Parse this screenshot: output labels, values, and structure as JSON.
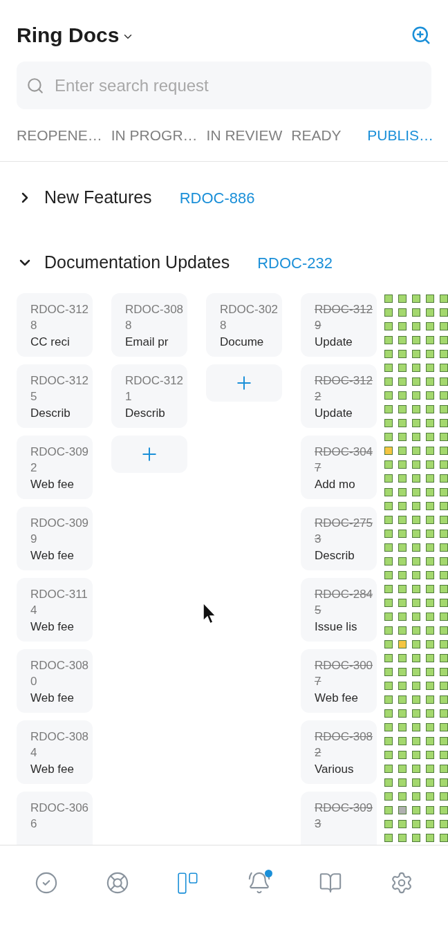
{
  "header": {
    "title": "Ring Docs"
  },
  "search": {
    "placeholder": "Enter search request"
  },
  "tabs": [
    {
      "label": "REOPENE…",
      "selected": false
    },
    {
      "label": "IN PROGR…",
      "selected": false
    },
    {
      "label": "IN REVIEW",
      "selected": false
    },
    {
      "label": "READY",
      "selected": false
    },
    {
      "label": "PUBLIS…",
      "selected": true
    }
  ],
  "groups": [
    {
      "name": "New Features",
      "issue": "RDOC-886",
      "expanded": false
    },
    {
      "name": "Documentation Updates",
      "issue": "RDOC-232",
      "expanded": true
    }
  ],
  "board": {
    "columns": [
      {
        "cards": [
          {
            "kind": "issue",
            "id": "RDOC-3128",
            "title": "CC reci",
            "resolved": false
          },
          {
            "kind": "issue",
            "id": "RDOC-3125",
            "title": "Describ",
            "resolved": false
          },
          {
            "kind": "issue",
            "id": "RDOC-3092",
            "title": "Web fee",
            "resolved": false
          },
          {
            "kind": "issue",
            "id": "RDOC-3099",
            "title": "Web fee",
            "resolved": false
          },
          {
            "kind": "issue",
            "id": "RDOC-3114",
            "title": "Web fee",
            "resolved": false
          },
          {
            "kind": "issue",
            "id": "RDOC-3080",
            "title": "Web fee",
            "resolved": false
          },
          {
            "kind": "issue",
            "id": "RDOC-3084",
            "title": "Web fee",
            "resolved": false
          },
          {
            "kind": "issue",
            "id": "RDOC-3066",
            "resolved": false
          }
        ]
      },
      {
        "cards": [
          {
            "kind": "issue",
            "id": "RDOC-3088",
            "title": "Email pr",
            "resolved": false
          },
          {
            "kind": "issue",
            "id": "RDOC-3121",
            "title": "Describ",
            "resolved": false
          },
          {
            "kind": "add"
          }
        ]
      },
      {
        "cards": [
          {
            "kind": "issue",
            "id": "RDOC-3028",
            "title": "Docume",
            "resolved": false
          },
          {
            "kind": "add"
          }
        ]
      },
      {
        "cards": [
          {
            "kind": "issue",
            "id": "RDOC-3129",
            "title": "Update",
            "resolved": true
          },
          {
            "kind": "issue",
            "id": "RDOC-3122",
            "title": "Update",
            "resolved": true
          },
          {
            "kind": "issue",
            "id": "RDOC-3047",
            "title": "Add mo",
            "resolved": true
          },
          {
            "kind": "issue",
            "id": "RDOC-2753",
            "title": "Describ",
            "resolved": true
          },
          {
            "kind": "issue",
            "id": "RDOC-2845",
            "title": "Issue lis",
            "resolved": true
          },
          {
            "kind": "issue",
            "id": "RDOC-3007",
            "title": "Web fee",
            "resolved": true
          },
          {
            "kind": "issue",
            "id": "RDOC-3082",
            "title": "Various",
            "resolved": true
          },
          {
            "kind": "issue",
            "id": "RDOC-3093",
            "resolved": true
          }
        ]
      }
    ]
  },
  "minimap": [
    {
      "cells": [
        {
          "color": "#a4d86e"
        },
        {
          "color": "#a4d86e"
        },
        {
          "color": "#a4d86e"
        },
        {
          "color": "#a4d86e"
        },
        {
          "color": "#a4d86e"
        }
      ]
    },
    {
      "cells": [
        {
          "color": "#a4d86e"
        },
        {
          "color": "#a4d86e"
        },
        {
          "color": "#a4d86e"
        },
        {
          "color": "#a4d86e"
        },
        {
          "color": "#a4d86e"
        }
      ]
    },
    {
      "cells": [
        {
          "color": "#a4d86e"
        },
        {
          "color": "#a4d86e"
        },
        {
          "color": "#a4d86e"
        },
        {
          "color": "#a4d86e"
        },
        {
          "color": "#a4d86e"
        }
      ]
    },
    {
      "cells": [
        {
          "color": "#a4d86e"
        },
        {
          "color": "#a4d86e"
        },
        {
          "color": "#a4d86e"
        },
        {
          "color": "#a4d86e"
        },
        {
          "color": "#a4d86e"
        }
      ]
    },
    {
      "cells": [
        {
          "color": "#a4d86e"
        },
        {
          "color": "#a4d86e"
        },
        {
          "color": "#a4d86e"
        },
        {
          "color": "#a4d86e"
        },
        {
          "color": "#a4d86e"
        }
      ]
    },
    {
      "cells": [
        {
          "color": "#a4d86e"
        },
        {
          "color": "#a4d86e"
        },
        {
          "color": "#a4d86e"
        },
        {
          "color": "#a4d86e"
        },
        {
          "color": "#a4d86e"
        }
      ]
    },
    {
      "cells": [
        {
          "color": "#a4d86e"
        },
        {
          "color": "#a4d86e"
        },
        {
          "color": "#a4d86e"
        },
        {
          "color": "#a4d86e"
        },
        {
          "color": "#a4d86e"
        }
      ]
    },
    {
      "cells": [
        {
          "color": "#a4d86e"
        },
        {
          "color": "#a4d86e"
        },
        {
          "color": "#a4d86e"
        },
        {
          "color": "#a4d86e"
        },
        {
          "color": "#a4d86e"
        }
      ]
    },
    {
      "cells": [
        {
          "color": "#a4d86e"
        },
        {
          "color": "#a4d86e"
        },
        {
          "color": "#a4d86e"
        },
        {
          "color": "#a4d86e"
        },
        {
          "color": "#a4d86e"
        }
      ]
    },
    {
      "cells": [
        {
          "color": "#a4d86e"
        },
        {
          "color": "#a4d86e"
        },
        {
          "color": "#a4d86e"
        },
        {
          "color": "#a4d86e"
        },
        {
          "color": "#a4d86e"
        }
      ]
    },
    {
      "cells": [
        {
          "color": "#a4d86e"
        },
        {
          "color": "#a4d86e"
        },
        {
          "color": "#a4d86e"
        },
        {
          "color": "#a4d86e"
        },
        {
          "color": "#a4d86e"
        }
      ]
    },
    {
      "cells": [
        {
          "color": "#f5c542"
        },
        {
          "color": "#a4d86e"
        },
        {
          "color": "#a4d86e"
        },
        {
          "color": "#a4d86e"
        },
        {
          "color": "#a4d86e"
        }
      ]
    },
    {
      "cells": [
        {
          "color": "#a4d86e"
        },
        {
          "color": "#a4d86e"
        },
        {
          "color": "#a4d86e"
        },
        {
          "color": "#a4d86e"
        },
        {
          "color": "#a4d86e"
        }
      ]
    },
    {
      "cells": [
        {
          "color": "#a4d86e"
        },
        {
          "color": "#a4d86e"
        },
        {
          "color": "#a4d86e"
        },
        {
          "color": "#a4d86e"
        },
        {
          "color": "#a4d86e"
        }
      ]
    },
    {
      "cells": [
        {
          "color": "#a4d86e"
        },
        {
          "color": "#a4d86e"
        },
        {
          "color": "#a4d86e"
        },
        {
          "color": "#a4d86e"
        },
        {
          "color": "#a4d86e"
        }
      ]
    },
    {
      "cells": [
        {
          "color": "#a4d86e"
        },
        {
          "color": "#a4d86e"
        },
        {
          "color": "#a4d86e"
        },
        {
          "color": "#a4d86e"
        },
        {
          "color": "#a4d86e"
        }
      ]
    },
    {
      "cells": [
        {
          "color": "#a4d86e"
        },
        {
          "color": "#a4d86e"
        },
        {
          "color": "#a4d86e"
        },
        {
          "color": "#a4d86e"
        },
        {
          "color": "#a4d86e"
        }
      ]
    },
    {
      "cells": [
        {
          "color": "#a4d86e"
        },
        {
          "color": "#a4d86e"
        },
        {
          "color": "#a4d86e"
        },
        {
          "color": "#a4d86e"
        },
        {
          "color": "#a4d86e"
        }
      ]
    },
    {
      "cells": [
        {
          "color": "#a4d86e"
        },
        {
          "color": "#a4d86e"
        },
        {
          "color": "#a4d86e"
        },
        {
          "color": "#a4d86e"
        },
        {
          "color": "#a4d86e"
        }
      ]
    },
    {
      "cells": [
        {
          "color": "#a4d86e"
        },
        {
          "color": "#a4d86e"
        },
        {
          "color": "#a4d86e"
        },
        {
          "color": "#a4d86e"
        },
        {
          "color": "#a4d86e"
        }
      ]
    },
    {
      "cells": [
        {
          "color": "#a4d86e"
        },
        {
          "color": "#a4d86e"
        },
        {
          "color": "#a4d86e"
        },
        {
          "color": "#a4d86e"
        },
        {
          "color": "#a4d86e"
        }
      ]
    },
    {
      "cells": [
        {
          "color": "#a4d86e"
        },
        {
          "color": "#a4d86e"
        },
        {
          "color": "#a4d86e"
        },
        {
          "color": "#a4d86e"
        },
        {
          "color": "#a4d86e"
        }
      ]
    },
    {
      "cells": [
        {
          "color": "#a4d86e"
        },
        {
          "color": "#a4d86e"
        },
        {
          "color": "#a4d86e"
        },
        {
          "color": "#a4d86e"
        },
        {
          "color": "#a4d86e"
        }
      ]
    },
    {
      "cells": [
        {
          "color": "#a4d86e"
        },
        {
          "color": "#a4d86e"
        },
        {
          "color": "#a4d86e"
        },
        {
          "color": "#a4d86e"
        },
        {
          "color": "#a4d86e"
        }
      ]
    },
    {
      "cells": [
        {
          "color": "#a4d86e"
        },
        {
          "color": "#a4d86e"
        },
        {
          "color": "#a4d86e"
        },
        {
          "color": "#a4d86e"
        },
        {
          "color": "#a4d86e"
        }
      ]
    },
    {
      "cells": [
        {
          "color": "#a4d86e"
        },
        {
          "color": "#f5c542"
        },
        {
          "color": "#a4d86e"
        },
        {
          "color": "#a4d86e"
        },
        {
          "color": "#a4d86e"
        }
      ]
    },
    {
      "cells": [
        {
          "color": "#a4d86e"
        },
        {
          "color": "#a4d86e"
        },
        {
          "color": "#a4d86e"
        },
        {
          "color": "#a4d86e"
        },
        {
          "color": "#a4d86e"
        }
      ]
    },
    {
      "cells": [
        {
          "color": "#a4d86e"
        },
        {
          "color": "#a4d86e"
        },
        {
          "color": "#a4d86e"
        },
        {
          "color": "#a4d86e"
        },
        {
          "color": "#a4d86e"
        }
      ]
    },
    {
      "cells": [
        {
          "color": "#a4d86e"
        },
        {
          "color": "#a4d86e"
        },
        {
          "color": "#a4d86e"
        },
        {
          "color": "#a4d86e"
        },
        {
          "color": "#a4d86e"
        }
      ]
    },
    {
      "cells": [
        {
          "color": "#a4d86e"
        },
        {
          "color": "#a4d86e"
        },
        {
          "color": "#a4d86e"
        },
        {
          "color": "#a4d86e"
        },
        {
          "color": "#a4d86e"
        }
      ]
    },
    {
      "cells": [
        {
          "color": "#a4d86e"
        },
        {
          "color": "#a4d86e"
        },
        {
          "color": "#a4d86e"
        },
        {
          "color": "#a4d86e"
        },
        {
          "color": "#a4d86e"
        }
      ]
    },
    {
      "cells": [
        {
          "color": "#a4d86e"
        },
        {
          "color": "#a4d86e"
        },
        {
          "color": "#a4d86e"
        },
        {
          "color": "#a4d86e"
        },
        {
          "color": "#a4d86e"
        }
      ]
    },
    {
      "cells": [
        {
          "color": "#a4d86e"
        },
        {
          "color": "#a4d86e"
        },
        {
          "color": "#a4d86e"
        },
        {
          "color": "#a4d86e"
        },
        {
          "color": "#a4d86e"
        }
      ]
    },
    {
      "cells": [
        {
          "color": "#a4d86e"
        },
        {
          "color": "#a4d86e"
        },
        {
          "color": "#a4d86e"
        },
        {
          "color": "#a4d86e"
        },
        {
          "color": "#a4d86e"
        }
      ]
    },
    {
      "cells": [
        {
          "color": "#a4d86e"
        },
        {
          "color": "#a4d86e"
        },
        {
          "color": "#a4d86e"
        },
        {
          "color": "#a4d86e"
        },
        {
          "color": "#a4d86e"
        }
      ]
    },
    {
      "cells": [
        {
          "color": "#a4d86e"
        },
        {
          "color": "#a4d86e"
        },
        {
          "color": "#a4d86e"
        },
        {
          "color": "#a4d86e"
        },
        {
          "color": "#a4d86e"
        }
      ]
    },
    {
      "cells": [
        {
          "color": "#a4d86e"
        },
        {
          "color": "#a4d86e"
        },
        {
          "color": "#a4d86e"
        },
        {
          "color": "#a4d86e"
        },
        {
          "color": "#a4d86e"
        }
      ]
    },
    {
      "cells": [
        {
          "color": "#a4d86e"
        },
        {
          "color": "#b0b0b0"
        },
        {
          "color": "#a4d86e"
        },
        {
          "color": "#a4d86e"
        },
        {
          "color": "#a4d86e"
        }
      ]
    },
    {
      "cells": [
        {
          "color": "#a4d86e"
        },
        {
          "color": "#a4d86e"
        },
        {
          "color": "#a4d86e"
        },
        {
          "color": "#a4d86e"
        },
        {
          "color": "#a4d86e"
        }
      ]
    },
    {
      "cells": [
        {
          "color": "#a4d86e"
        },
        {
          "color": "#a4d86e"
        },
        {
          "color": "#a4d86e"
        },
        {
          "color": "#a4d86e"
        },
        {
          "color": "#a4d86e"
        }
      ]
    }
  ],
  "nav": [
    {
      "kind": "tasks",
      "selected": false,
      "badge": false
    },
    {
      "kind": "help",
      "selected": false,
      "badge": false
    },
    {
      "kind": "board",
      "selected": true,
      "badge": false
    },
    {
      "kind": "notifications",
      "selected": false,
      "badge": true
    },
    {
      "kind": "knowledge",
      "selected": false,
      "badge": false
    },
    {
      "kind": "settings",
      "selected": false,
      "badge": false
    }
  ]
}
